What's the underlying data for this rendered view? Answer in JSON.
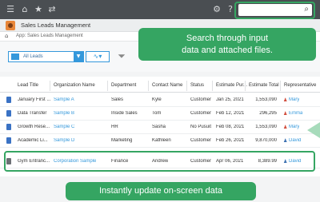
{
  "app": {
    "title": "Sales Leads Management",
    "breadcrumb": "App: Sales Leads Management"
  },
  "topbar": {
    "icons": [
      "menu-icon",
      "home-icon",
      "star-icon",
      "swap-icon",
      "gear-icon",
      "help-icon"
    ],
    "search_icon": "search-icon"
  },
  "toolbar": {
    "view_label": "All Leads",
    "graph_icon": "line-graph-icon",
    "filter_icon": "filter-icon"
  },
  "callout_search": {
    "line1": "Search through input",
    "line2": "data and attached files."
  },
  "callout_update": {
    "text": "Instantly update on-screen data"
  },
  "table": {
    "columns": [
      "Lead Title",
      "Organization Name",
      "Department",
      "Contact Name",
      "Status",
      "Estimate Pur...",
      "Estimate Total",
      "Representative"
    ],
    "rows": [
      {
        "lead": "January First ...",
        "org": "Sample A",
        "dept": "Sales",
        "contact": "Kyle",
        "status": "Customer",
        "date": "Jan 25, 2021",
        "total": "1,553,090",
        "rep": "Mary",
        "rep_gender": "f"
      },
      {
        "lead": "Data Transfer",
        "org": "Sample B",
        "dept": "Inside Sales",
        "contact": "Tom",
        "status": "Customer",
        "date": "Feb 12, 2021",
        "total": "296,295",
        "rep": "Emma",
        "rep_gender": "f"
      },
      {
        "lead": "Growth Rese...",
        "org": "Sample C",
        "dept": "HR",
        "contact": "Sasha",
        "status": "No Pusuit",
        "date": "Feb 08, 2021",
        "total": "1,553,090",
        "rep": "Mary",
        "rep_gender": "f"
      },
      {
        "lead": "Academic Li...",
        "org": "Sample D",
        "dept": "Marketing",
        "contact": "Kathleen",
        "status": "Customer",
        "date": "Feb 26, 2021",
        "total": "9,870,000",
        "rep": "David",
        "rep_gender": "m"
      },
      {
        "lead": "Gym Entranc...",
        "org": "Corporation Sample",
        "dept": "Finance",
        "contact": "Andrew",
        "status": "Customer",
        "date": "Apr 06, 2021",
        "total": "8,389.99",
        "rep": "David",
        "rep_gender": "m"
      }
    ]
  },
  "colors": {
    "accent_green": "#35a562",
    "link_blue": "#3498db",
    "topbar": "#4a4e52"
  }
}
